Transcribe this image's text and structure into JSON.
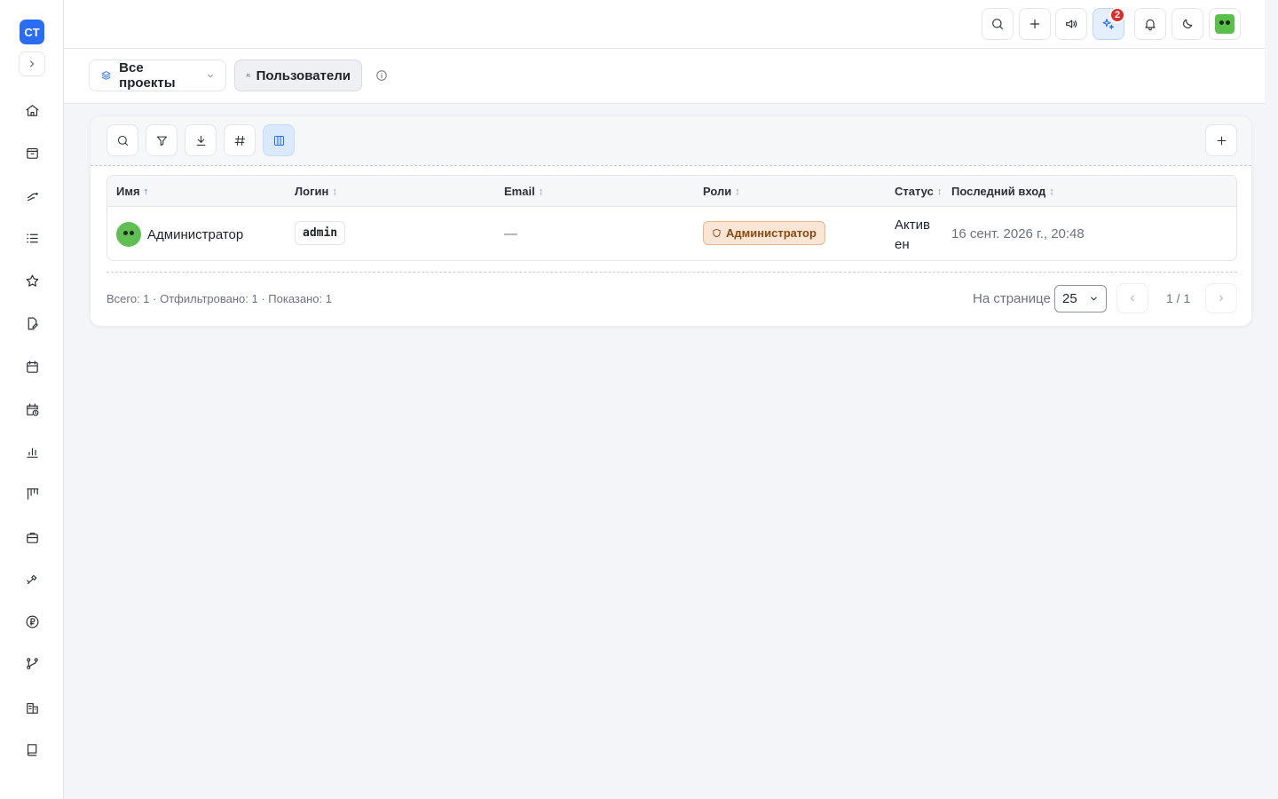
{
  "app": {
    "logo_text": "CT"
  },
  "subheader": {
    "projects_label": "Все проекты",
    "users_label": "Пользователи"
  },
  "topbar": {
    "notifications_badge": "2"
  },
  "table": {
    "columns": [
      {
        "label": "Имя",
        "sort": "↑"
      },
      {
        "label": "Логин",
        "sort": "↕"
      },
      {
        "label": "Email",
        "sort": "↕"
      },
      {
        "label": "Роли",
        "sort": "↕"
      },
      {
        "label": "Статус",
        "sort": "↕"
      },
      {
        "label": "Последний вход",
        "sort": "↕"
      }
    ],
    "rows": [
      {
        "name": "Администратор",
        "login": "admin",
        "email": "—",
        "role": "Администратор",
        "status_line1": "Актив",
        "status_line2": "ен",
        "last_login": "16 сент. 2026 г., 20:48"
      }
    ]
  },
  "footer": {
    "totals": "Всего: 1 · Отфильтровано: 1 · Показано: 1",
    "per_page_label": "На странице",
    "per_page_value": "25",
    "prev": "‹",
    "next": "›",
    "page_info": "1 / 1"
  },
  "colors": {
    "accent": "#2a6df5",
    "badge": "#e02b2b",
    "role_bg": "#fbe6d5",
    "role_text": "#8a4a12"
  }
}
